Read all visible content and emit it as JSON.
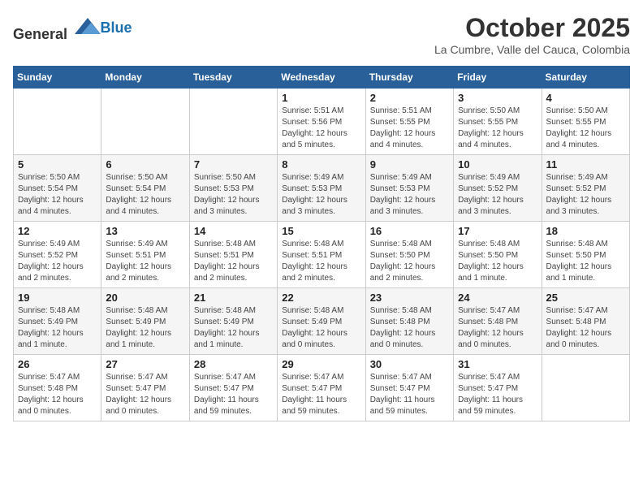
{
  "header": {
    "logo_general": "General",
    "logo_blue": "Blue",
    "month": "October 2025",
    "location": "La Cumbre, Valle del Cauca, Colombia"
  },
  "weekdays": [
    "Sunday",
    "Monday",
    "Tuesday",
    "Wednesday",
    "Thursday",
    "Friday",
    "Saturday"
  ],
  "weeks": [
    [
      {
        "day": "",
        "detail": ""
      },
      {
        "day": "",
        "detail": ""
      },
      {
        "day": "",
        "detail": ""
      },
      {
        "day": "1",
        "detail": "Sunrise: 5:51 AM\nSunset: 5:56 PM\nDaylight: 12 hours\nand 5 minutes."
      },
      {
        "day": "2",
        "detail": "Sunrise: 5:51 AM\nSunset: 5:55 PM\nDaylight: 12 hours\nand 4 minutes."
      },
      {
        "day": "3",
        "detail": "Sunrise: 5:50 AM\nSunset: 5:55 PM\nDaylight: 12 hours\nand 4 minutes."
      },
      {
        "day": "4",
        "detail": "Sunrise: 5:50 AM\nSunset: 5:55 PM\nDaylight: 12 hours\nand 4 minutes."
      }
    ],
    [
      {
        "day": "5",
        "detail": "Sunrise: 5:50 AM\nSunset: 5:54 PM\nDaylight: 12 hours\nand 4 minutes."
      },
      {
        "day": "6",
        "detail": "Sunrise: 5:50 AM\nSunset: 5:54 PM\nDaylight: 12 hours\nand 4 minutes."
      },
      {
        "day": "7",
        "detail": "Sunrise: 5:50 AM\nSunset: 5:53 PM\nDaylight: 12 hours\nand 3 minutes."
      },
      {
        "day": "8",
        "detail": "Sunrise: 5:49 AM\nSunset: 5:53 PM\nDaylight: 12 hours\nand 3 minutes."
      },
      {
        "day": "9",
        "detail": "Sunrise: 5:49 AM\nSunset: 5:53 PM\nDaylight: 12 hours\nand 3 minutes."
      },
      {
        "day": "10",
        "detail": "Sunrise: 5:49 AM\nSunset: 5:52 PM\nDaylight: 12 hours\nand 3 minutes."
      },
      {
        "day": "11",
        "detail": "Sunrise: 5:49 AM\nSunset: 5:52 PM\nDaylight: 12 hours\nand 3 minutes."
      }
    ],
    [
      {
        "day": "12",
        "detail": "Sunrise: 5:49 AM\nSunset: 5:52 PM\nDaylight: 12 hours\nand 2 minutes."
      },
      {
        "day": "13",
        "detail": "Sunrise: 5:49 AM\nSunset: 5:51 PM\nDaylight: 12 hours\nand 2 minutes."
      },
      {
        "day": "14",
        "detail": "Sunrise: 5:48 AM\nSunset: 5:51 PM\nDaylight: 12 hours\nand 2 minutes."
      },
      {
        "day": "15",
        "detail": "Sunrise: 5:48 AM\nSunset: 5:51 PM\nDaylight: 12 hours\nand 2 minutes."
      },
      {
        "day": "16",
        "detail": "Sunrise: 5:48 AM\nSunset: 5:50 PM\nDaylight: 12 hours\nand 2 minutes."
      },
      {
        "day": "17",
        "detail": "Sunrise: 5:48 AM\nSunset: 5:50 PM\nDaylight: 12 hours\nand 1 minute."
      },
      {
        "day": "18",
        "detail": "Sunrise: 5:48 AM\nSunset: 5:50 PM\nDaylight: 12 hours\nand 1 minute."
      }
    ],
    [
      {
        "day": "19",
        "detail": "Sunrise: 5:48 AM\nSunset: 5:49 PM\nDaylight: 12 hours\nand 1 minute."
      },
      {
        "day": "20",
        "detail": "Sunrise: 5:48 AM\nSunset: 5:49 PM\nDaylight: 12 hours\nand 1 minute."
      },
      {
        "day": "21",
        "detail": "Sunrise: 5:48 AM\nSunset: 5:49 PM\nDaylight: 12 hours\nand 1 minute."
      },
      {
        "day": "22",
        "detail": "Sunrise: 5:48 AM\nSunset: 5:49 PM\nDaylight: 12 hours\nand 0 minutes."
      },
      {
        "day": "23",
        "detail": "Sunrise: 5:48 AM\nSunset: 5:48 PM\nDaylight: 12 hours\nand 0 minutes."
      },
      {
        "day": "24",
        "detail": "Sunrise: 5:47 AM\nSunset: 5:48 PM\nDaylight: 12 hours\nand 0 minutes."
      },
      {
        "day": "25",
        "detail": "Sunrise: 5:47 AM\nSunset: 5:48 PM\nDaylight: 12 hours\nand 0 minutes."
      }
    ],
    [
      {
        "day": "26",
        "detail": "Sunrise: 5:47 AM\nSunset: 5:48 PM\nDaylight: 12 hours\nand 0 minutes."
      },
      {
        "day": "27",
        "detail": "Sunrise: 5:47 AM\nSunset: 5:47 PM\nDaylight: 12 hours\nand 0 minutes."
      },
      {
        "day": "28",
        "detail": "Sunrise: 5:47 AM\nSunset: 5:47 PM\nDaylight: 11 hours\nand 59 minutes."
      },
      {
        "day": "29",
        "detail": "Sunrise: 5:47 AM\nSunset: 5:47 PM\nDaylight: 11 hours\nand 59 minutes."
      },
      {
        "day": "30",
        "detail": "Sunrise: 5:47 AM\nSunset: 5:47 PM\nDaylight: 11 hours\nand 59 minutes."
      },
      {
        "day": "31",
        "detail": "Sunrise: 5:47 AM\nSunset: 5:47 PM\nDaylight: 11 hours\nand 59 minutes."
      },
      {
        "day": "",
        "detail": ""
      }
    ]
  ]
}
